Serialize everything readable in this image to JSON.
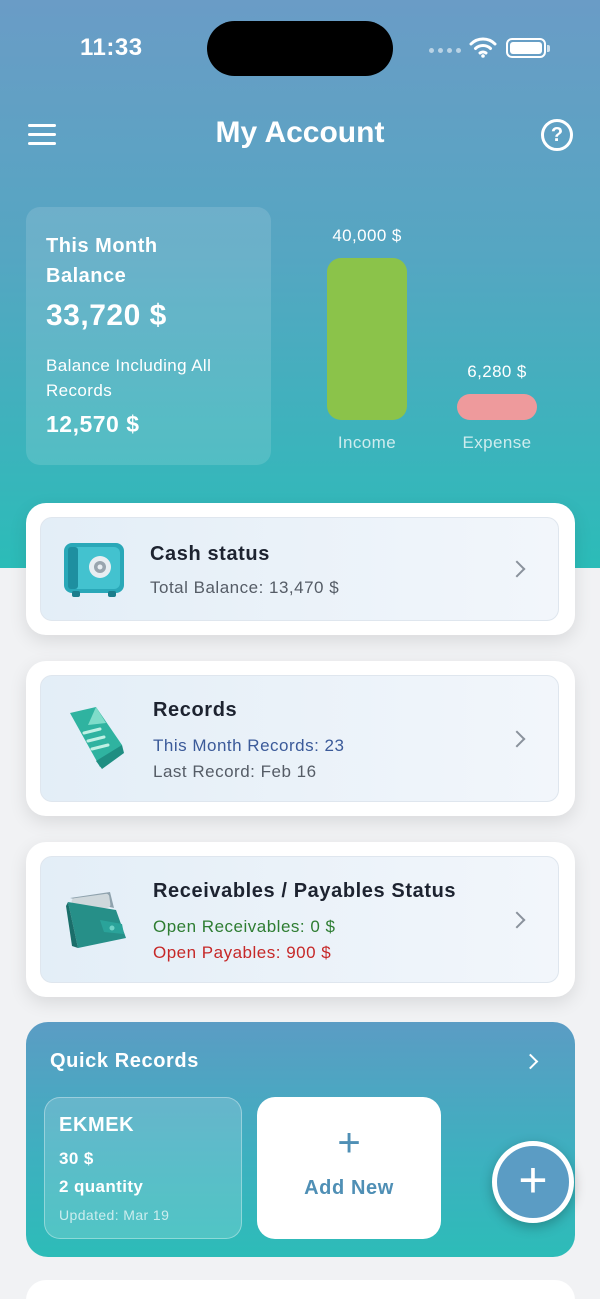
{
  "status_bar": {
    "time": "11:33"
  },
  "header": {
    "title": "My Account",
    "menu_icon": "hamburger-menu-icon",
    "help_icon": "help-circle-icon",
    "help_glyph": "?"
  },
  "balance": {
    "month_label": "This Month Balance",
    "month_value": "33,720 $",
    "all_label": "Balance Including All Records",
    "all_value": "12,570 $"
  },
  "chart_data": {
    "type": "bar",
    "categories": [
      "Income",
      "Expense"
    ],
    "values": [
      40000,
      6280
    ],
    "value_labels": [
      "40,000 $",
      "6,280 $"
    ],
    "colors": [
      "#8bc34a",
      "#ee9a9c"
    ]
  },
  "cards": {
    "cash": {
      "title": "Cash status",
      "line1": "Total Balance: 13,470 $",
      "icon": "safe-icon"
    },
    "records": {
      "title": "Records",
      "line1": "This Month Records: 23",
      "line2": "Last Record: Feb 16",
      "icon": "document-icon"
    },
    "receivables": {
      "title": "Receivables / Payables Status",
      "line1": "Open Receivables: 0 $",
      "line2": "Open Payables: 900 $",
      "icon": "wallet-icon"
    }
  },
  "colors": {
    "receivable": "#2e7d32",
    "payable": "#c62828",
    "records_blue": "#3b5a99"
  },
  "quick_records": {
    "title": "Quick Records",
    "items": [
      {
        "name": "EKMEK",
        "price": "30 $",
        "quantity": "2 quantity",
        "updated": "Updated: Mar 19"
      }
    ],
    "add_label": "Add New",
    "plus": "+"
  },
  "fab": {
    "glyph": "+"
  }
}
